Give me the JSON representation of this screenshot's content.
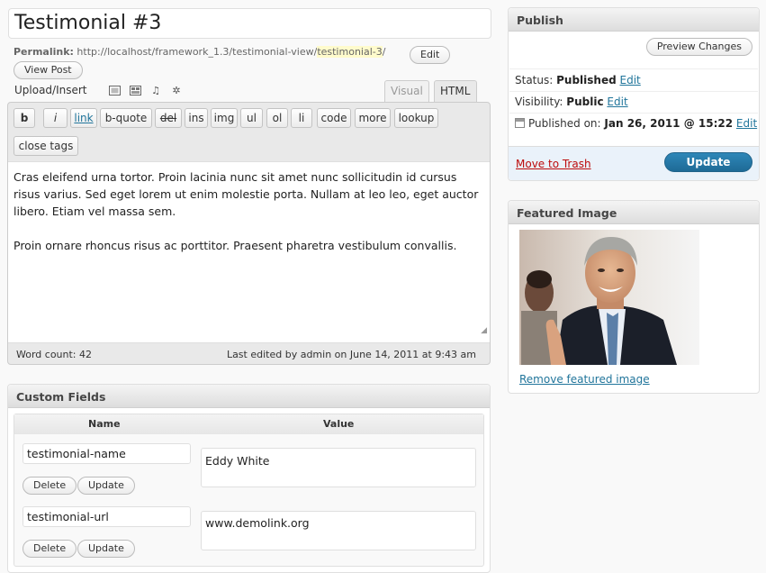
{
  "post": {
    "title": "Testimonial #3",
    "permalink_label": "Permalink:",
    "permalink_base": "http://localhost/framework_1.3/testimonial-view/",
    "permalink_slug": "testimonial-3",
    "permalink_trail": "/",
    "edit_label": "Edit",
    "view_post_label": "View Post"
  },
  "editor": {
    "upload_label": "Upload/Insert",
    "media_icons": [
      "image-icon",
      "video-icon",
      "audio-icon",
      "media-icon"
    ],
    "tab_visual": "Visual",
    "tab_html": "HTML",
    "quicktags": [
      "b",
      "i",
      "link",
      "b-quote",
      "del",
      "ins",
      "img",
      "ul",
      "ol",
      "li",
      "code",
      "more",
      "lookup",
      "close tags"
    ],
    "paragraphs": [
      "Cras eleifend urna tortor. Proin lacinia nunc sit amet nunc sollicitudin id cursus risus varius. Sed eget lorem ut enim molestie porta. Nullam at leo leo, eget auctor libero. Etiam vel massa sem.",
      "Proin ornare rhoncus risus ac porttitor. Praesent pharetra vestibulum convallis."
    ],
    "word_count": "Word count: 42",
    "last_edited": "Last edited by admin on June 14, 2011 at 9:43 am"
  },
  "custom_fields": {
    "title": "Custom Fields",
    "col_name": "Name",
    "col_value": "Value",
    "rows": [
      {
        "name": "testimonial-name",
        "value": "Eddy White"
      },
      {
        "name": "testimonial-url",
        "value": "www.demolink.org"
      }
    ],
    "delete_label": "Delete",
    "update_label": "Update"
  },
  "publish": {
    "title": "Publish",
    "preview_label": "Preview Changes",
    "status_label": "Status:",
    "status_value": "Published",
    "visibility_label": "Visibility:",
    "visibility_value": "Public",
    "published_label": "Published on:",
    "published_value": "Jan 26, 2011 @ 15:22",
    "edit_label": "Edit",
    "trash_label": "Move to Trash",
    "update_label": "Update"
  },
  "featured": {
    "title": "Featured Image",
    "remove_label": "Remove featured image"
  }
}
